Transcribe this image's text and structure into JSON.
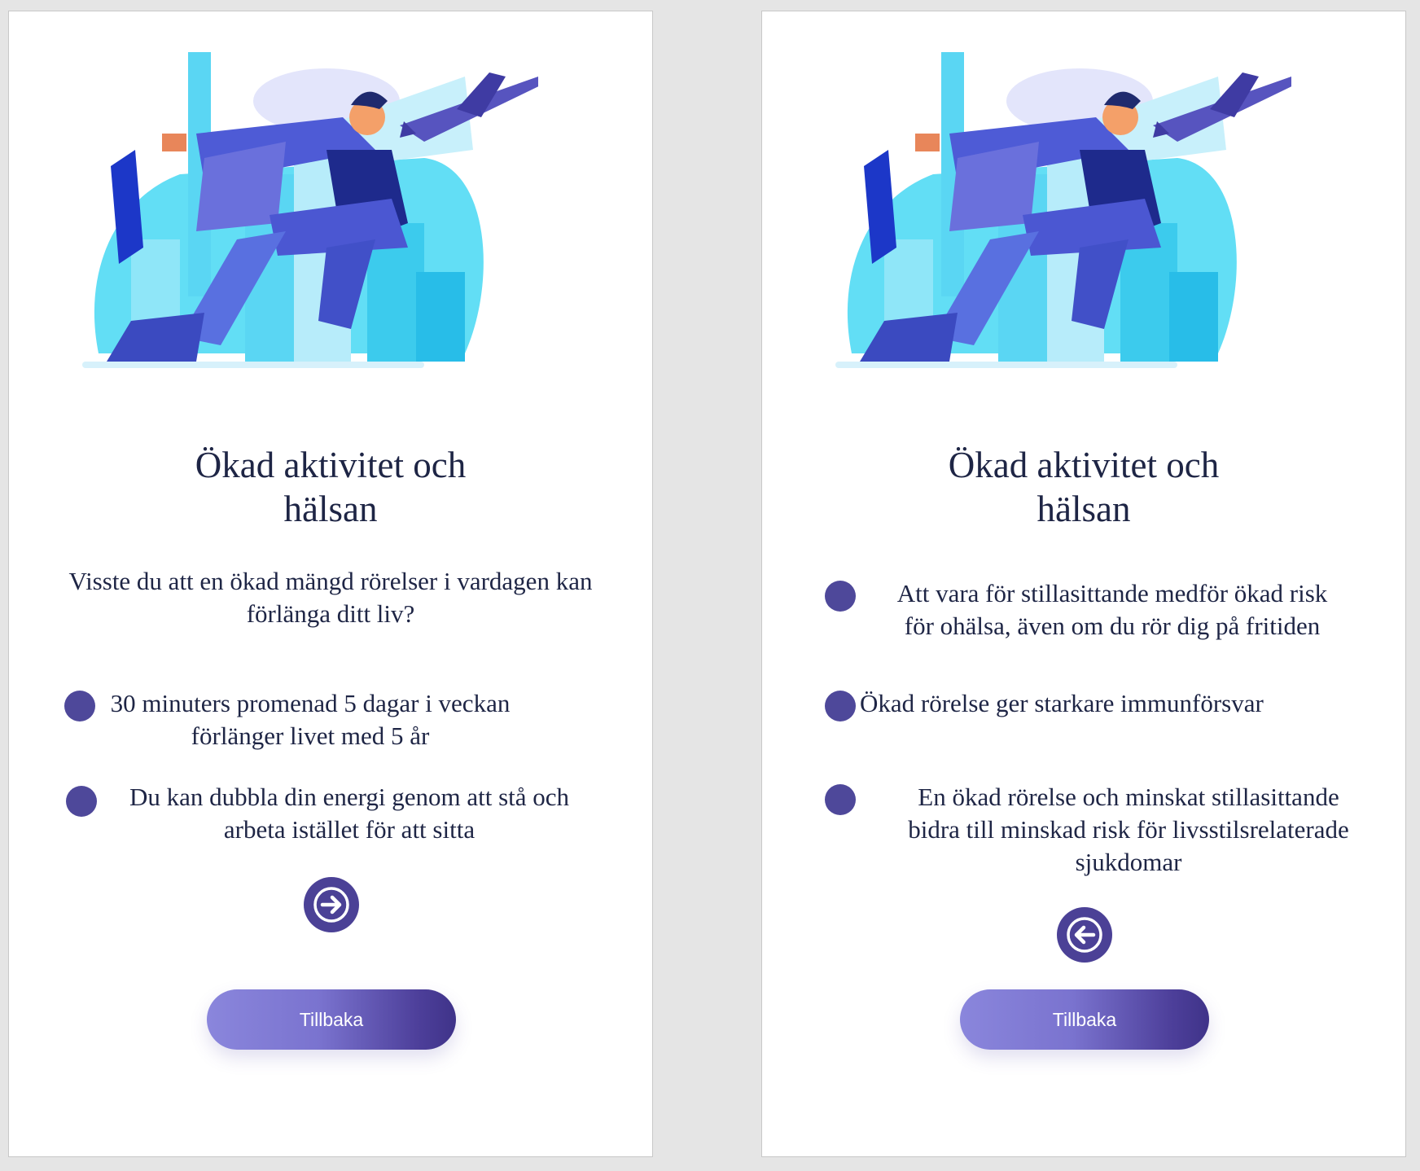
{
  "colors": {
    "accent": "#4b4196",
    "text": "#1e2545",
    "button_gradient_start": "#8a86dc",
    "button_gradient_end": "#3f3389"
  },
  "left_card": {
    "title_line1": "Ökad aktivitet och",
    "title_line2": "hälsan",
    "intro": "Visste du att en ökad mängd rörelser i vardagen kan förlänga ditt liv?",
    "bullets": [
      {
        "line1": "30 minuters promenad 5 dagar i veckan",
        "line2": "förlänger livet med 5 år"
      },
      {
        "line1": "Du kan dubbla din energi genom att stå och",
        "line2": "arbeta istället för att sitta"
      }
    ],
    "nav_icon": "arrow-right-icon",
    "back_label": "Tillbaka"
  },
  "right_card": {
    "title_line1": "Ökad aktivitet och",
    "title_line2": "hälsan",
    "bullets": [
      {
        "line1": "Att vara för stillasittande medför ökad risk",
        "line2": "för ohälsa, även om du rör dig på fritiden"
      },
      {
        "line1": "Ökad rörelse ger starkare immunförsvar"
      },
      {
        "line1": "En ökad rörelse och minskat stillasittande",
        "line2": "bidra till minskad risk för livsstilsrelaterade",
        "line3": "sjukdomar"
      }
    ],
    "nav_icon": "arrow-left-icon",
    "back_label": "Tillbaka"
  }
}
